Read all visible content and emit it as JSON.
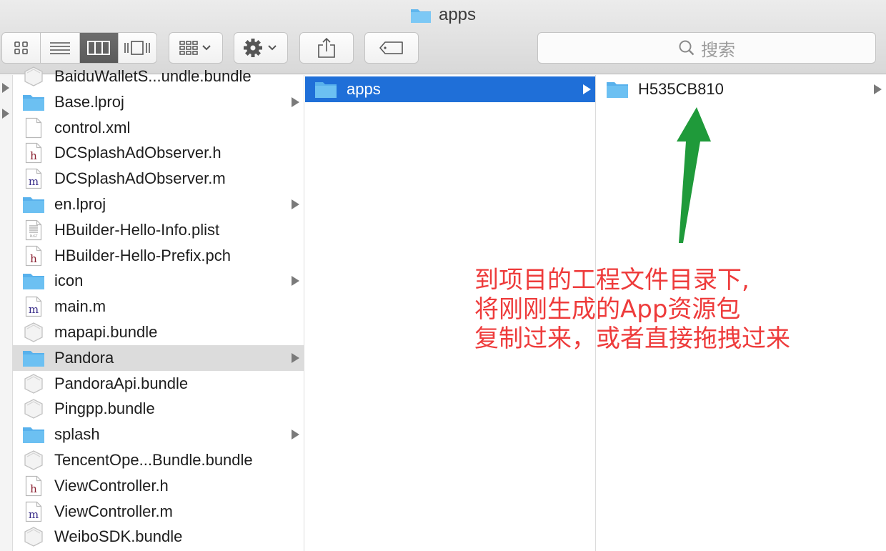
{
  "window": {
    "title": "apps"
  },
  "toolbar": {
    "view_modes": [
      "icon-view-icon",
      "list-view-icon",
      "column-view-icon",
      "cover-flow-icon"
    ],
    "active_view": "column-view-icon",
    "search_placeholder": "搜索"
  },
  "columns": {
    "col1": [
      {
        "name": "BaiduWalletS...undle.bundle",
        "type": "bundle",
        "has_children": false
      },
      {
        "name": "Base.lproj",
        "type": "folder",
        "has_children": true
      },
      {
        "name": "control.xml",
        "type": "file",
        "has_children": false
      },
      {
        "name": "DCSplashAdObserver.h",
        "type": "h",
        "has_children": false
      },
      {
        "name": "DCSplashAdObserver.m",
        "type": "m",
        "has_children": false
      },
      {
        "name": "en.lproj",
        "type": "folder",
        "has_children": true
      },
      {
        "name": "HBuilder-Hello-Info.plist",
        "type": "plist",
        "has_children": false
      },
      {
        "name": "HBuilder-Hello-Prefix.pch",
        "type": "h",
        "has_children": false
      },
      {
        "name": "icon",
        "type": "folder",
        "has_children": true
      },
      {
        "name": "main.m",
        "type": "m",
        "has_children": false
      },
      {
        "name": "mapapi.bundle",
        "type": "bundle",
        "has_children": false
      },
      {
        "name": "Pandora",
        "type": "folder",
        "has_children": true,
        "selected": true
      },
      {
        "name": "PandoraApi.bundle",
        "type": "bundle",
        "has_children": false
      },
      {
        "name": "Pingpp.bundle",
        "type": "bundle",
        "has_children": false
      },
      {
        "name": "splash",
        "type": "folder",
        "has_children": true
      },
      {
        "name": "TencentOpe...Bundle.bundle",
        "type": "bundle",
        "has_children": false
      },
      {
        "name": "ViewController.h",
        "type": "h",
        "has_children": false
      },
      {
        "name": "ViewController.m",
        "type": "m",
        "has_children": false
      },
      {
        "name": "WeiboSDK.bundle",
        "type": "bundle",
        "has_children": false
      }
    ],
    "col2": [
      {
        "name": "apps",
        "type": "folder",
        "has_children": true,
        "selected": true
      }
    ],
    "col3": [
      {
        "name": "H535CB810",
        "type": "folder",
        "has_children": true
      }
    ]
  },
  "annotation": {
    "lines": [
      "到项目的工程文件目录下,",
      "将刚刚生成的App资源包",
      "复制过来，或者直接拖拽过来"
    ],
    "color": "#ee3b3b",
    "arrow_color": "#1f9a3a"
  },
  "colors": {
    "folder": "#6cc0f2",
    "selection_blue": "#1f6fd8",
    "selection_grey": "#dcdcdc"
  }
}
